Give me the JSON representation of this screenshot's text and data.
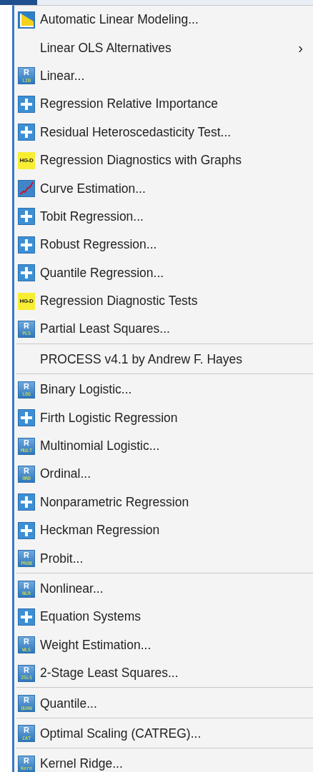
{
  "menu": {
    "items": [
      {
        "kind": "item",
        "label": "Automatic Linear Modeling...",
        "icon": {
          "kind": "auto"
        }
      },
      {
        "kind": "item",
        "label": "Linear OLS Alternatives",
        "submenu_arrow": "›"
      },
      {
        "kind": "item",
        "label": "Linear...",
        "icon": {
          "kind": "r",
          "top": "R",
          "bottom": "LIN"
        }
      },
      {
        "kind": "item",
        "label": "Regression Relative Importance",
        "icon": {
          "kind": "plus"
        }
      },
      {
        "kind": "item",
        "label": "Residual Heteroscedasticity Test...",
        "icon": {
          "kind": "plus"
        }
      },
      {
        "kind": "item",
        "label": "Regression Diagnostics with Graphs",
        "icon": {
          "kind": "hgd",
          "text": "HG-D"
        }
      },
      {
        "kind": "item",
        "label": "Curve Estimation...",
        "icon": {
          "kind": "curve"
        }
      },
      {
        "kind": "item",
        "label": "Tobit Regression...",
        "icon": {
          "kind": "plus"
        }
      },
      {
        "kind": "item",
        "label": "Robust Regression...",
        "icon": {
          "kind": "plus"
        }
      },
      {
        "kind": "item",
        "label": "Quantile Regression...",
        "icon": {
          "kind": "plus"
        }
      },
      {
        "kind": "item",
        "label": "Regression Diagnostic Tests",
        "icon": {
          "kind": "hgd",
          "text": "HG-D"
        }
      },
      {
        "kind": "item",
        "label": "Partial Least Squares...",
        "icon": {
          "kind": "r",
          "top": "R",
          "bottom": "PLS"
        }
      },
      {
        "kind": "separator"
      },
      {
        "kind": "item",
        "label": "PROCESS v4.1 by Andrew F. Hayes"
      },
      {
        "kind": "separator"
      },
      {
        "kind": "item",
        "label": "Binary Logistic...",
        "icon": {
          "kind": "r",
          "top": "R",
          "bottom": "LOG"
        }
      },
      {
        "kind": "item",
        "label": "Firth Logistic Regression",
        "icon": {
          "kind": "plus"
        }
      },
      {
        "kind": "item",
        "label": "Multinomial Logistic...",
        "icon": {
          "kind": "r",
          "top": "R",
          "bottom": "MULT"
        }
      },
      {
        "kind": "item",
        "label": "Ordinal...",
        "icon": {
          "kind": "r",
          "top": "R",
          "bottom": "ORD"
        }
      },
      {
        "kind": "item",
        "label": "Nonparametric Regression",
        "icon": {
          "kind": "plus"
        }
      },
      {
        "kind": "item",
        "label": "Heckman Regression",
        "icon": {
          "kind": "plus"
        }
      },
      {
        "kind": "item",
        "label": "Probit...",
        "icon": {
          "kind": "r",
          "top": "R",
          "bottom": "PROB"
        }
      },
      {
        "kind": "separator"
      },
      {
        "kind": "item",
        "label": "Nonlinear...",
        "icon": {
          "kind": "r",
          "top": "R",
          "bottom": "NLR"
        }
      },
      {
        "kind": "item",
        "label": "Equation Systems",
        "icon": {
          "kind": "plus"
        }
      },
      {
        "kind": "item",
        "label": "Weight Estimation...",
        "icon": {
          "kind": "r",
          "top": "R",
          "bottom": "WLS"
        }
      },
      {
        "kind": "item",
        "label": "2-Stage Least Squares...",
        "icon": {
          "kind": "r",
          "top": "R",
          "bottom": "2SLS"
        }
      },
      {
        "kind": "separator"
      },
      {
        "kind": "item",
        "label": "Quantile...",
        "icon": {
          "kind": "r",
          "top": "R",
          "bottom": "QUAN"
        }
      },
      {
        "kind": "separator"
      },
      {
        "kind": "item",
        "label": "Optimal Scaling (CATREG)...",
        "icon": {
          "kind": "r",
          "top": "R",
          "bottom": "CAT"
        }
      },
      {
        "kind": "separator"
      },
      {
        "kind": "item",
        "label": "Kernel Ridge...",
        "icon": {
          "kind": "r",
          "top": "R",
          "bottom": "Kern"
        }
      }
    ]
  }
}
